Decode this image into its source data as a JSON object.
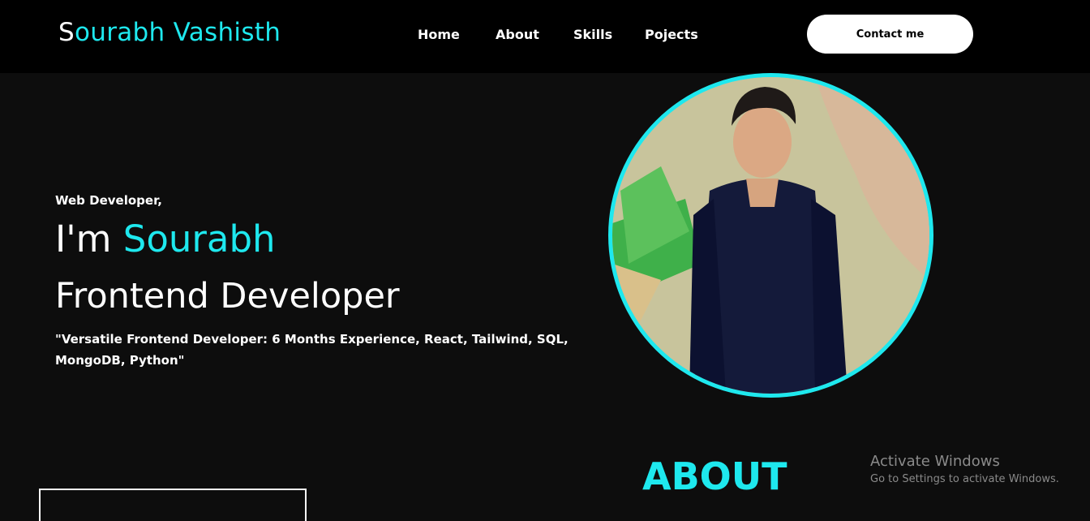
{
  "header": {
    "logo_first": "S",
    "logo_rest": "ourabh Vashisth",
    "nav": [
      "Home",
      "About",
      "Skills",
      "Pojects"
    ],
    "contact_label": "Contact me"
  },
  "hero": {
    "tagline": "Web Developer,",
    "intro_prefix": "I'm ",
    "intro_name": "Sourabh",
    "role": "Frontend Developer",
    "description": "\"Versatile Frontend Developer: 6 Months Experience, React, Tailwind, SQL, MongoDB, Python\""
  },
  "about": {
    "title": "ABOUT"
  },
  "watermark": {
    "title": "Activate Windows",
    "subtitle": "Go to Settings to activate Windows."
  },
  "colors": {
    "accent": "#1ee8ee",
    "navbar": "#000000",
    "background": "#0d0d0d"
  }
}
